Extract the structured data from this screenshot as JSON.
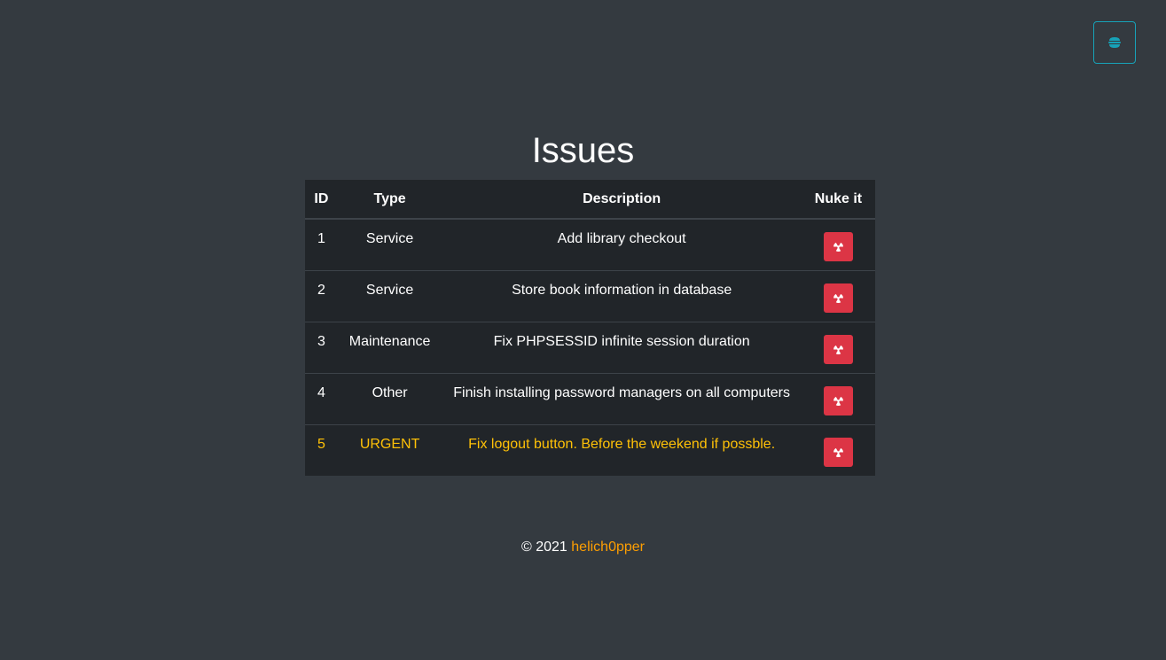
{
  "header": {
    "menu_icon": "hamburger-icon"
  },
  "page": {
    "title": "Issues"
  },
  "table": {
    "columns": [
      "ID",
      "Type",
      "Description",
      "Nuke it"
    ],
    "rows": [
      {
        "id": "1",
        "type": "Service",
        "description": "Add library checkout",
        "urgent": false
      },
      {
        "id": "2",
        "type": "Service",
        "description": "Store book information in database",
        "urgent": false
      },
      {
        "id": "3",
        "type": "Maintenance",
        "description": "Fix PHPSESSID infinite session duration",
        "urgent": false
      },
      {
        "id": "4",
        "type": "Other",
        "description": "Finish installing password managers on all computers",
        "urgent": false
      },
      {
        "id": "5",
        "type": "URGENT",
        "description": "Fix logout button. Before the weekend if possble.",
        "urgent": true
      }
    ],
    "action_icon": "radiation-icon"
  },
  "footer": {
    "copyright": "© 2021",
    "author": "helich0pper"
  },
  "colors": {
    "background": "#343a40",
    "table_background": "#212529",
    "menu_border": "#17a2b8",
    "nuke_button": "#dc3545",
    "urgent_text": "#ffc107",
    "author_link": "#fd9e02"
  }
}
